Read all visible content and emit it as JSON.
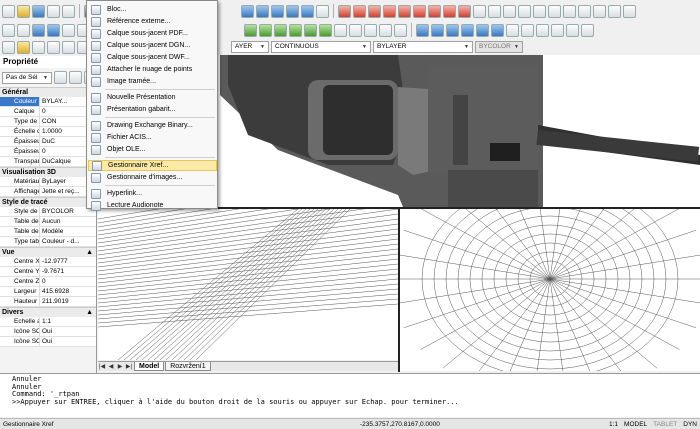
{
  "toolbar": {
    "layer_combo": "AYER",
    "linetype_combo": "CONTINUOUS",
    "lineweight_combo": "BYLAYER",
    "plotstyle_combo": "BYCOLOR"
  },
  "menu": {
    "items": [
      {
        "label": "Bloc...",
        "icon": "block-icon"
      },
      {
        "label": "Référence externe...",
        "icon": "xref-icon"
      },
      {
        "label": "Calque sous-jacent PDF...",
        "icon": "pdf-underlay-icon"
      },
      {
        "label": "Calque sous-jacent DGN...",
        "icon": "dgn-underlay-icon"
      },
      {
        "label": "Calque sous-jacent DWF...",
        "icon": "dwf-underlay-icon"
      },
      {
        "label": "Attacher le nuage de points",
        "icon": "point-cloud-icon"
      },
      {
        "label": "Image tramée...",
        "icon": "raster-image-icon"
      },
      {
        "label": "Nouvelle Présentation",
        "icon": "new-layout-icon"
      },
      {
        "label": "Présentation gabarit...",
        "icon": "layout-template-icon"
      },
      {
        "label": "Drawing Exchange Binary...",
        "icon": "dxb-icon"
      },
      {
        "label": "Fichier ACIS...",
        "icon": "acis-icon"
      },
      {
        "label": "Objet OLE...",
        "icon": "ole-icon"
      },
      {
        "label": "Gestionnaire Xref...",
        "icon": "xref-manager-icon"
      },
      {
        "label": "Gestionnaire d'images...",
        "icon": "image-manager-icon"
      },
      {
        "label": "Hyperlink...",
        "icon": "hyperlink-icon"
      },
      {
        "label": "Lecture Audionote",
        "icon": "audionote-icon"
      }
    ]
  },
  "properties": {
    "title": "Propriété",
    "selection_combo": "Pas de Sél",
    "sections": {
      "general": {
        "title": "Général",
        "rows": [
          {
            "k": "Couleur",
            "v": "BYLAY..."
          },
          {
            "k": "Calque",
            "v": "0"
          },
          {
            "k": "Type de li...",
            "v": "CON"
          },
          {
            "k": "Échelle du...",
            "v": "1.0000"
          },
          {
            "k": "Épaisseur...",
            "v": "DuC"
          },
          {
            "k": "Épaisseur",
            "v": "0"
          },
          {
            "k": "Transpare...",
            "v": "DuCalque"
          }
        ]
      },
      "vis3d": {
        "title": "Visualisation 3D",
        "rows": [
          {
            "k": "Matériau",
            "v": "ByLayer"
          },
          {
            "k": "Affichage ...",
            "v": "Jette et reç..."
          }
        ]
      },
      "plot": {
        "title": "Style de tracé",
        "rows": [
          {
            "k": "Style de tr...",
            "v": "BYCOLOR"
          },
          {
            "k": "Table des ...",
            "v": "Aucun"
          },
          {
            "k": "Table des ...",
            "v": "Modèle"
          },
          {
            "k": "Type tabl...",
            "v": "Couleur - d..."
          }
        ]
      },
      "view": {
        "title": "Vue",
        "rows": [
          {
            "k": "Centre X",
            "v": "-12.9777"
          },
          {
            "k": "Centre Y",
            "v": "-9.7671"
          },
          {
            "k": "Centre Z",
            "v": "0"
          },
          {
            "k": "Largeur",
            "v": "415.6928"
          },
          {
            "k": "Hauteur",
            "v": "211.9019"
          }
        ]
      },
      "misc": {
        "title": "Divers",
        "rows": [
          {
            "k": "Echelle an...",
            "v": "1:1"
          },
          {
            "k": "Icône SCU...",
            "v": "Oui"
          },
          {
            "k": "Icône SCU...",
            "v": "Oui"
          }
        ]
      }
    }
  },
  "layout_tabs": [
    "Model",
    "Rozvržení1"
  ],
  "command_lines": [
    "Annuler",
    "Annuler",
    "Command: '_rtpan",
    ">>Appuyer sur ENTREE, cliquer à l'aide du bouton droit de la souris ou appuyer sur Echap. pour terminer..."
  ],
  "status": {
    "message": "Gestionnaire Xref",
    "coords": "-235.3757,270.8167,0.0000",
    "scale": "1:1",
    "model": "MODEL",
    "tablet": "TABLET",
    "dyn": "DYN"
  }
}
